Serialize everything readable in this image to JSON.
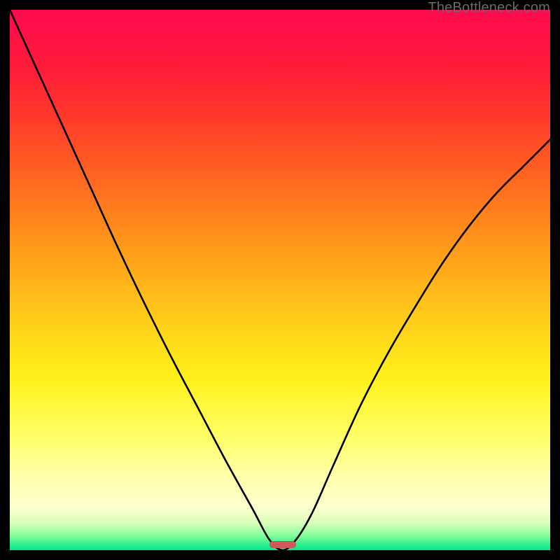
{
  "watermark": {
    "text": "TheBottleneck.com"
  },
  "chart_data": {
    "type": "line",
    "title": "",
    "xlabel": "",
    "ylabel": "",
    "xlim": [
      0,
      1
    ],
    "ylim": [
      0,
      1
    ],
    "series": [
      {
        "name": "bottleneck-curve",
        "x": [
          0.0,
          0.05,
          0.1,
          0.15,
          0.2,
          0.25,
          0.3,
          0.35,
          0.4,
          0.45,
          0.48,
          0.505,
          0.53,
          0.56,
          0.6,
          0.65,
          0.7,
          0.75,
          0.8,
          0.85,
          0.9,
          0.95,
          1.0
        ],
        "y": [
          1.0,
          0.89,
          0.78,
          0.67,
          0.56,
          0.455,
          0.355,
          0.26,
          0.165,
          0.075,
          0.02,
          0.0,
          0.02,
          0.07,
          0.16,
          0.27,
          0.365,
          0.45,
          0.53,
          0.6,
          0.66,
          0.71,
          0.76
        ]
      }
    ],
    "marker": {
      "name": "optimal-point",
      "x": 0.505,
      "y": 0.0,
      "width": 0.05,
      "color": "#cf5a5a"
    },
    "background_gradient": {
      "top": "#ff0a4f",
      "mid": "#fff01a",
      "bottom": "#00e88a"
    }
  }
}
